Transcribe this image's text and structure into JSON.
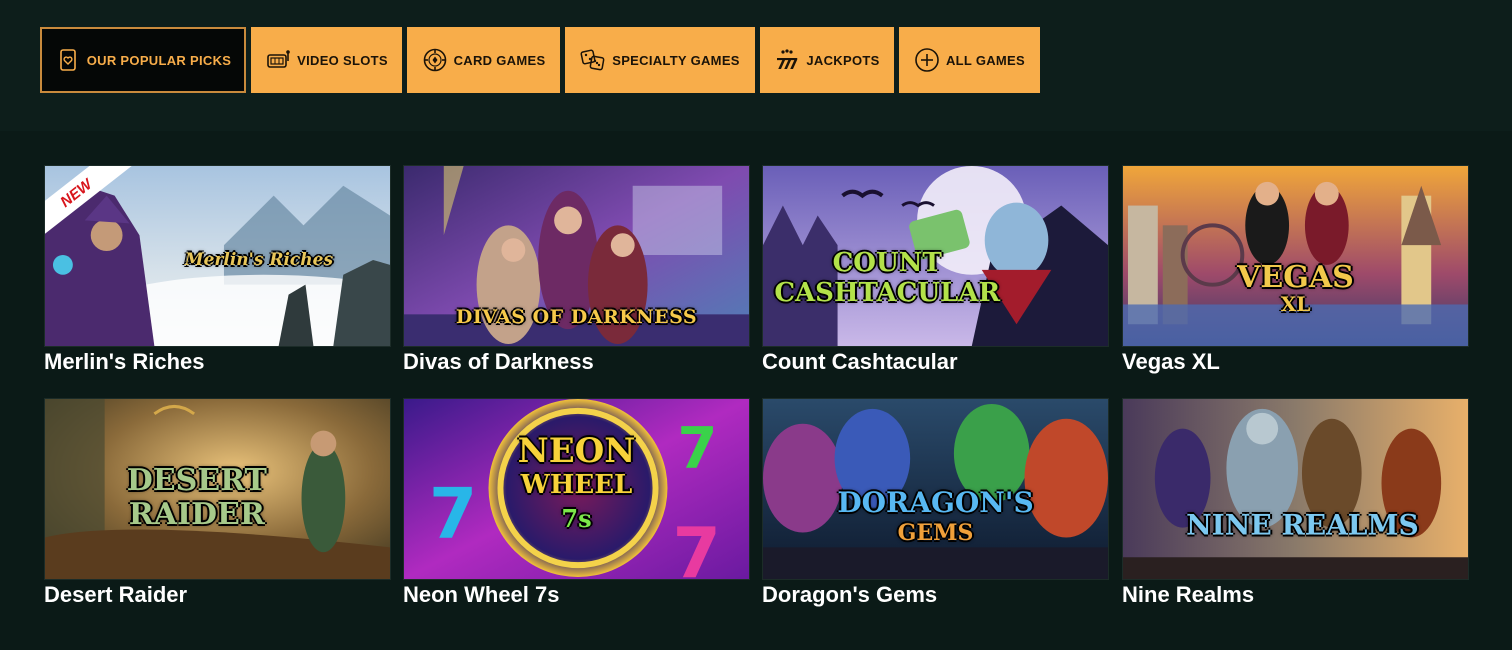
{
  "tabs": [
    {
      "label": "OUR POPULAR PICKS",
      "icon": "heart-card-icon",
      "active": true
    },
    {
      "label": "VIDEO SLOTS",
      "icon": "slot-machine-icon",
      "active": false
    },
    {
      "label": "CARD GAMES",
      "icon": "poker-chip-icon",
      "active": false
    },
    {
      "label": "SPECIALTY GAMES",
      "icon": "dice-icon",
      "active": false
    },
    {
      "label": "JACKPOTS",
      "icon": "sevens-icon",
      "active": false
    },
    {
      "label": "ALL GAMES",
      "icon": "plus-circle-icon",
      "active": false
    }
  ],
  "games": [
    {
      "name": "Merlin's Riches",
      "art_title": "Merlin's Riches",
      "badge": "NEW"
    },
    {
      "name": "Divas of Darkness",
      "art_title": "DIVAS OF DARKNESS",
      "badge": ""
    },
    {
      "name": "Count Cashtacular",
      "art_title_1": "COUNT",
      "art_title_2": "CASHTACULAR",
      "badge": ""
    },
    {
      "name": "Vegas XL",
      "art_title_1": "VEGAS",
      "art_title_2": "XL",
      "badge": ""
    },
    {
      "name": "Desert Raider",
      "art_title_1": "DESERT",
      "art_title_2": "RAIDER",
      "badge": ""
    },
    {
      "name": "Neon Wheel 7s",
      "art_title_1": "NEON",
      "art_title_2": "WHEEL",
      "art_title_3": "7s",
      "badge": ""
    },
    {
      "name": "Doragon's Gems",
      "art_title_1": "DORAGON'S",
      "art_title_2": "GEMS",
      "badge": ""
    },
    {
      "name": "Nine Realms",
      "art_title": "NINE REALMS",
      "badge": ""
    }
  ],
  "colors": {
    "background": "#0b1a17",
    "tab": "#f8ad4a",
    "tab_active_border": "#c98a3c"
  }
}
